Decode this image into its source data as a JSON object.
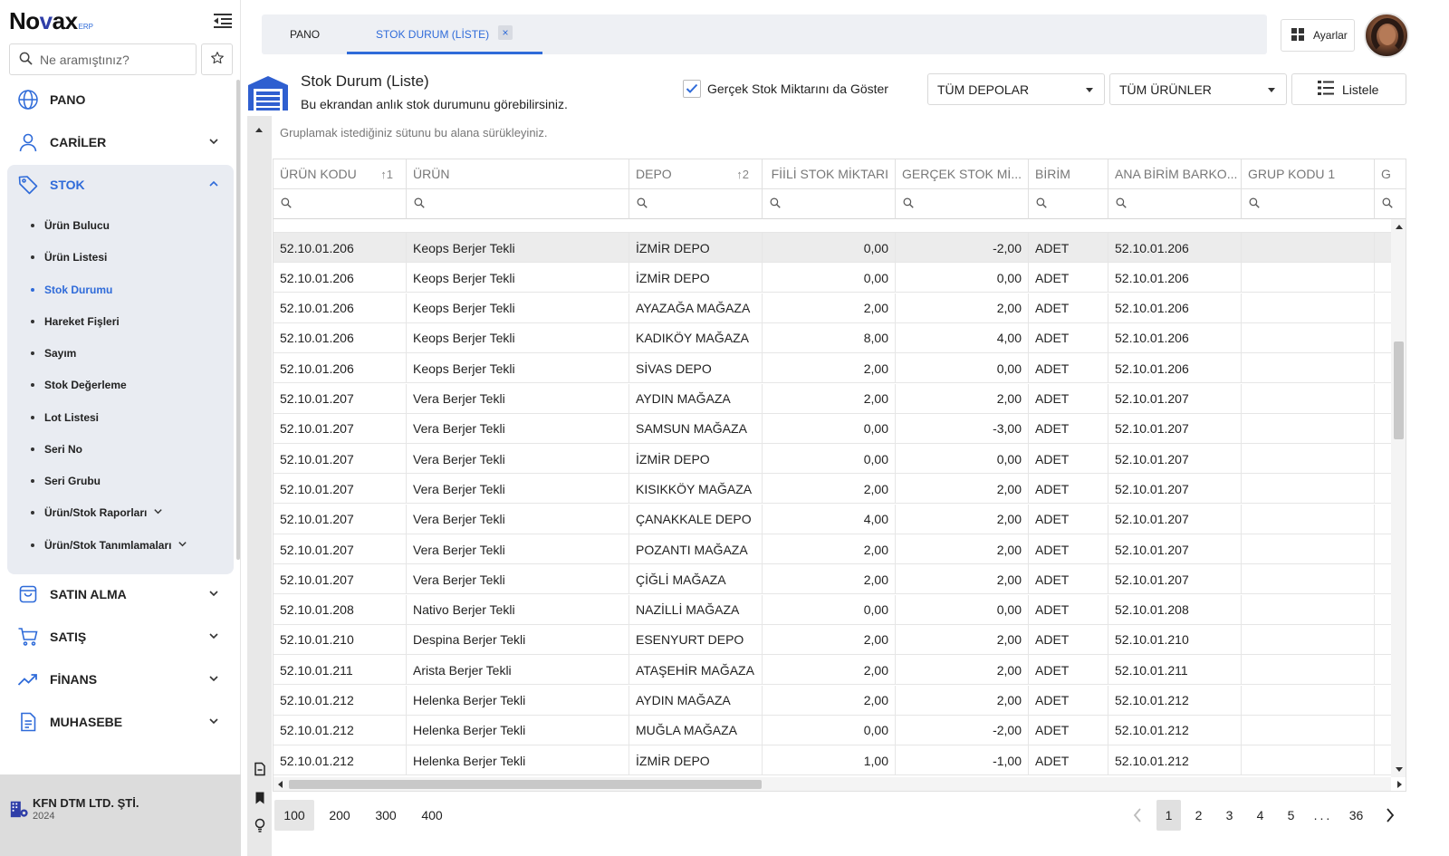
{
  "app": {
    "logo_text": "No",
    "logo_x": "v",
    "logo_tail": "ax",
    "logo_sub": "ERP"
  },
  "search": {
    "placeholder": "Ne aramıştınız?"
  },
  "sidebar": {
    "items": [
      {
        "label": "PANO",
        "icon": "globe-icon"
      },
      {
        "label": "CARİLER",
        "icon": "user-icon"
      },
      {
        "label": "STOK",
        "icon": "tag-icon"
      },
      {
        "label": "SATIN ALMA",
        "icon": "bag-icon"
      },
      {
        "label": "SATIŞ",
        "icon": "cart-icon"
      },
      {
        "label": "FİNANS",
        "icon": "trend-icon"
      },
      {
        "label": "MUHASEBE",
        "icon": "document-icon"
      }
    ],
    "stok_sub": [
      "Ürün Bulucu",
      "Ürün Listesi",
      "Stok Durumu",
      "Hareket Fişleri",
      "Sayım",
      "Stok Değerleme",
      "Lot Listesi",
      "Seri No",
      "Seri Grubu",
      "Ürün/Stok Raporları",
      "Ürün/Stok Tanımlamaları"
    ],
    "company_name": "KFN DTM LTD. ŞTİ.",
    "company_year": "2024"
  },
  "tabs": {
    "pano": "PANO",
    "stok": "STOK DURUM (LİSTE)",
    "close": "×"
  },
  "header": {
    "settings_label": "Ayarlar"
  },
  "page": {
    "title": "Stok Durum (Liste)",
    "subtitle": "Bu ekrandan anlık stok durumunu görebilirsiniz.",
    "checkbox_label": "Gerçek Stok Miktarını da Göster",
    "checkbox_checked": true,
    "depo_select": "TÜM DEPOLAR",
    "urun_select": "TÜM ÜRÜNLER",
    "list_button": "Listele",
    "group_panel": "Gruplamak istediğiniz sütunu bu alana sürükleyiniz."
  },
  "grid": {
    "columns": [
      {
        "label": "ÜRÜN KODU",
        "sort": "↑1"
      },
      {
        "label": "ÜRÜN",
        "sort": ""
      },
      {
        "label": "DEPO",
        "sort": "↑2"
      },
      {
        "label": "FİİLİ STOK MİKTARI",
        "sort": ""
      },
      {
        "label": "GERÇEK STOK Mİ...",
        "sort": ""
      },
      {
        "label": "BİRİM",
        "sort": ""
      },
      {
        "label": "ANA BİRİM BARKO...",
        "sort": ""
      },
      {
        "label": "GRUP KODU 1",
        "sort": ""
      },
      {
        "label": "G",
        "sort": ""
      }
    ],
    "rows": [
      [
        "52.10.01.206",
        "Keops Berjer Tekli",
        "İZMİR DEPO",
        "0,00",
        "-2,00",
        "ADET",
        "52.10.01.206",
        "",
        ""
      ],
      [
        "52.10.01.206",
        "Keops Berjer Tekli",
        "İZMİR DEPO",
        "0,00",
        "0,00",
        "ADET",
        "52.10.01.206",
        "",
        ""
      ],
      [
        "52.10.01.206",
        "Keops Berjer Tekli",
        "AYAZAĞA MAĞAZA",
        "2,00",
        "2,00",
        "ADET",
        "52.10.01.206",
        "",
        ""
      ],
      [
        "52.10.01.206",
        "Keops Berjer Tekli",
        "KADIKÖY MAĞAZA",
        "8,00",
        "4,00",
        "ADET",
        "52.10.01.206",
        "",
        ""
      ],
      [
        "52.10.01.206",
        "Keops Berjer Tekli",
        "SİVAS DEPO",
        "2,00",
        "0,00",
        "ADET",
        "52.10.01.206",
        "",
        ""
      ],
      [
        "52.10.01.207",
        "Vera Berjer Tekli",
        "AYDIN MAĞAZA",
        "2,00",
        "2,00",
        "ADET",
        "52.10.01.207",
        "",
        ""
      ],
      [
        "52.10.01.207",
        "Vera Berjer Tekli",
        "SAMSUN MAĞAZA",
        "0,00",
        "-3,00",
        "ADET",
        "52.10.01.207",
        "",
        ""
      ],
      [
        "52.10.01.207",
        "Vera Berjer Tekli",
        "İZMİR DEPO",
        "0,00",
        "0,00",
        "ADET",
        "52.10.01.207",
        "",
        ""
      ],
      [
        "52.10.01.207",
        "Vera Berjer Tekli",
        "KISIKKÖY MAĞAZA",
        "2,00",
        "2,00",
        "ADET",
        "52.10.01.207",
        "",
        ""
      ],
      [
        "52.10.01.207",
        "Vera Berjer Tekli",
        "ÇANAKKALE DEPO",
        "4,00",
        "2,00",
        "ADET",
        "52.10.01.207",
        "",
        ""
      ],
      [
        "52.10.01.207",
        "Vera Berjer Tekli",
        "POZANTI MAĞAZA",
        "2,00",
        "2,00",
        "ADET",
        "52.10.01.207",
        "",
        ""
      ],
      [
        "52.10.01.207",
        "Vera Berjer Tekli",
        "ÇİĞLİ MAĞAZA",
        "2,00",
        "2,00",
        "ADET",
        "52.10.01.207",
        "",
        ""
      ],
      [
        "52.10.01.208",
        "Nativo Berjer Tekli",
        "NAZİLLİ MAĞAZA",
        "0,00",
        "0,00",
        "ADET",
        "52.10.01.208",
        "",
        ""
      ],
      [
        "52.10.01.210",
        "Despina Berjer Tekli",
        "ESENYURT DEPO",
        "2,00",
        "2,00",
        "ADET",
        "52.10.01.210",
        "",
        ""
      ],
      [
        "52.10.01.211",
        "Arista Berjer Tekli",
        "ATAŞEHİR MAĞAZA",
        "2,00",
        "2,00",
        "ADET",
        "52.10.01.211",
        "",
        ""
      ],
      [
        "52.10.01.212",
        "Helenka Berjer Tekli",
        "AYDIN MAĞAZA",
        "2,00",
        "2,00",
        "ADET",
        "52.10.01.212",
        "",
        ""
      ],
      [
        "52.10.01.212",
        "Helenka Berjer Tekli",
        "MUĞLA MAĞAZA",
        "0,00",
        "-2,00",
        "ADET",
        "52.10.01.212",
        "",
        ""
      ],
      [
        "52.10.01.212",
        "Helenka Berjer Tekli",
        "İZMİR DEPO",
        "1,00",
        "-1,00",
        "ADET",
        "52.10.01.212",
        "",
        ""
      ]
    ]
  },
  "pager": {
    "sizes": [
      "100",
      "200",
      "300",
      "400"
    ],
    "active_size": "100",
    "pages": [
      "1",
      "2",
      "3",
      "4",
      "5",
      "...",
      "36"
    ],
    "active_page": "1"
  },
  "colors": {
    "accent": "#2f6bd9",
    "brand": "#2f3ea8"
  }
}
